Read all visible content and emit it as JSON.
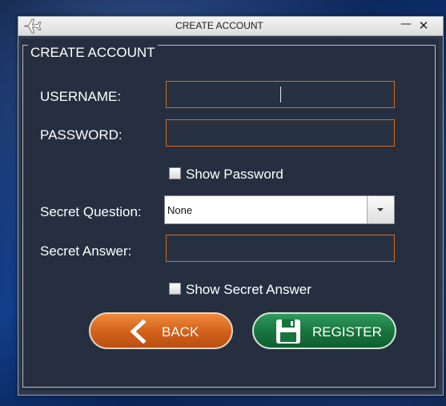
{
  "window": {
    "title": "CREATE ACCOUNT",
    "minimize_glyph": "—",
    "close_glyph": "✕",
    "app_icon": "airplane-icon"
  },
  "form": {
    "group_title": "CREATE ACCOUNT",
    "username": {
      "label": "USERNAME:",
      "value": ""
    },
    "password": {
      "label": "PASSWORD:",
      "value": ""
    },
    "show_password": {
      "label": "Show Password",
      "checked": false
    },
    "secret_question": {
      "label": "Secret Question:",
      "selected": "None"
    },
    "secret_answer": {
      "label": "Secret Answer:",
      "value": ""
    },
    "show_secret_answer": {
      "label": "Show Secret Answer",
      "checked": false
    }
  },
  "buttons": {
    "back": {
      "label": "BACK",
      "icon": "chevron-left-icon"
    },
    "register": {
      "label": "REGISTER",
      "icon": "floppy-disk-icon"
    }
  },
  "colors": {
    "field_border": "#d96a1c",
    "back_button": "#d2601a",
    "register_button": "#17733d",
    "panel_background": "#252f40"
  }
}
